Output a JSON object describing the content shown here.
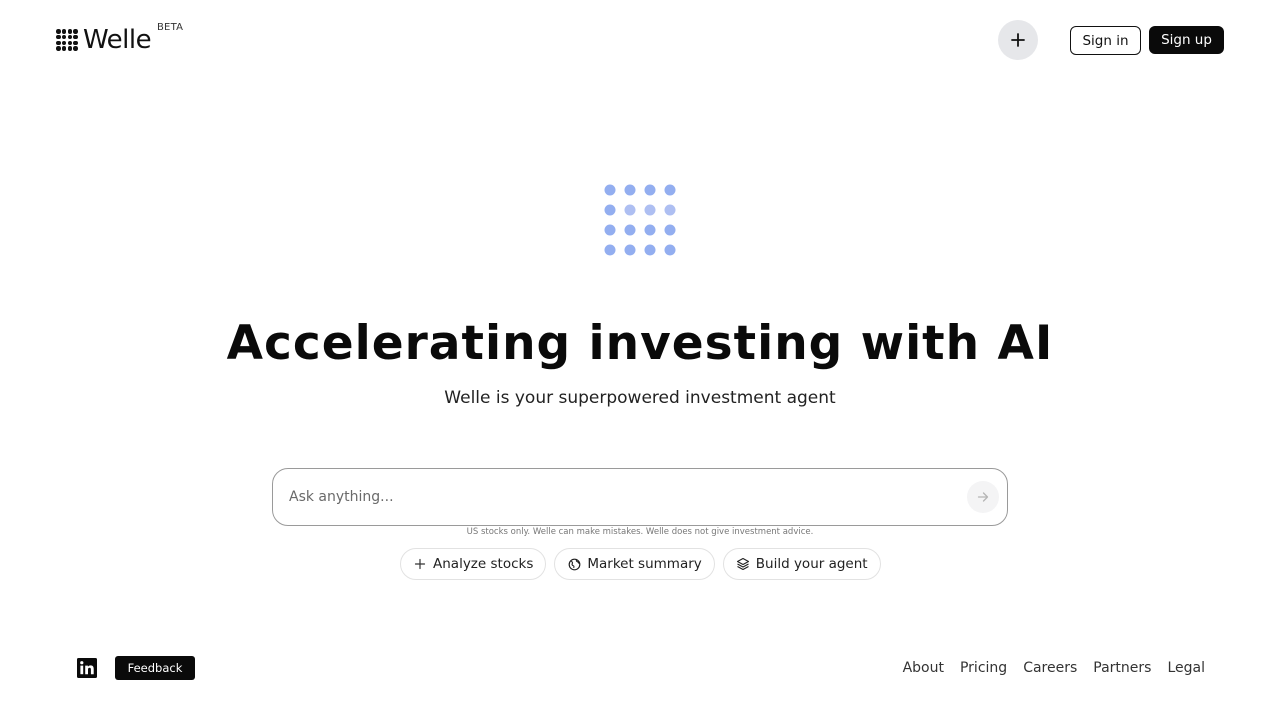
{
  "header": {
    "logo_text": "Welle",
    "beta_badge": "BETA",
    "new_button_icon": "plus-icon",
    "sign_in_label": "Sign in",
    "sign_up_label": "Sign up"
  },
  "hero": {
    "icon": "dot-grid-icon",
    "accent_color": "#93aef0",
    "headline": "Accelerating investing with AI",
    "subheadline": "Welle is your superpowered investment agent"
  },
  "search": {
    "placeholder": "Ask anything...",
    "value": "",
    "send_icon": "arrow-right-icon",
    "disclaimer": "US stocks only. Welle can make mistakes. Welle does not give investment advice."
  },
  "suggestions": [
    {
      "icon": "plus-icon",
      "label": "Analyze stocks"
    },
    {
      "icon": "globe-icon",
      "label": "Market summary"
    },
    {
      "icon": "layers-icon",
      "label": "Build your agent"
    }
  ],
  "footer": {
    "social_icon": "linkedin-icon",
    "feedback_label": "Feedback",
    "links": [
      {
        "label": "About"
      },
      {
        "label": "Pricing"
      },
      {
        "label": "Careers"
      },
      {
        "label": "Partners"
      },
      {
        "label": "Legal"
      }
    ]
  }
}
